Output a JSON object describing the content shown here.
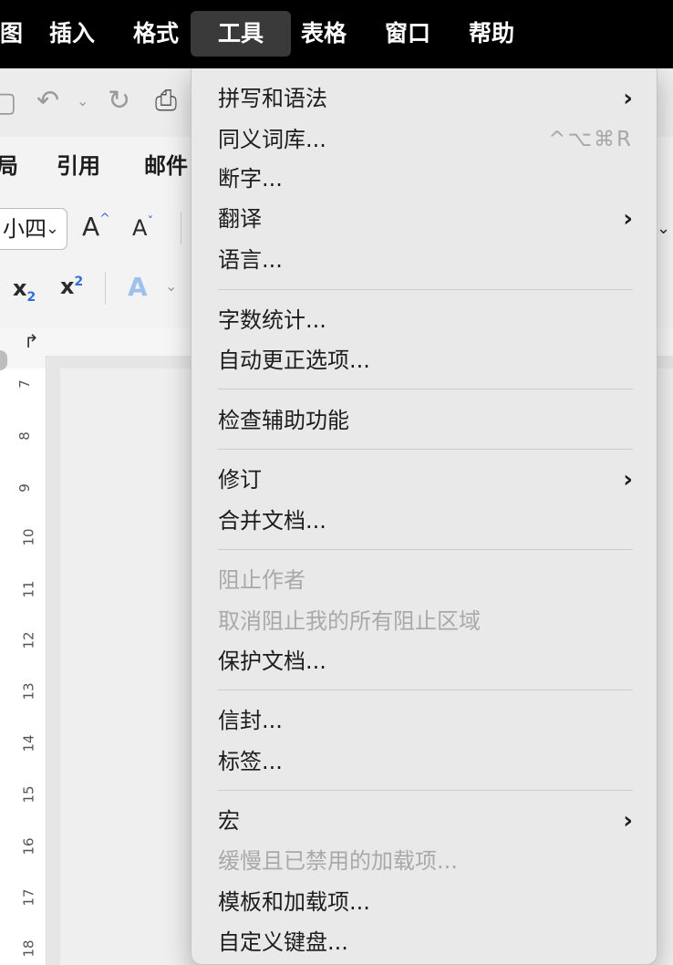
{
  "menubar": {
    "items": [
      "图",
      "插入",
      "格式",
      "工具",
      "表格",
      "窗口",
      "帮助"
    ],
    "active": "工具"
  },
  "ribbon": {
    "tabs": [
      "局",
      "引用",
      "邮件"
    ],
    "font_size": "小四",
    "subscript_label": "x",
    "subscript_mark": "2",
    "superscript_label": "x",
    "superscript_mark": "2",
    "grow_font": "A",
    "shrink_font": "A",
    "text_effect": "A"
  },
  "ruler": {
    "numbers": [
      "7",
      "8",
      "9",
      "10",
      "11",
      "12",
      "13",
      "14",
      "15",
      "16",
      "17",
      "18"
    ]
  },
  "tools_menu": {
    "spelling_grammar": "拼写和语法",
    "thesaurus": "同义词库...",
    "thesaurus_shortcut": "^⌥⌘R",
    "hyphenation": "断字...",
    "translate": "翻译",
    "language": "语言...",
    "word_count": "字数统计...",
    "autocorrect": "自动更正选项...",
    "check_accessibility": "检查辅助功能",
    "track_changes": "修订",
    "merge_documents": "合并文档...",
    "block_authors": "阻止作者",
    "unblock_all": "取消阻止我的所有阻止区域",
    "protect_document": "保护文档...",
    "envelopes": "信封...",
    "labels": "标签...",
    "macros": "宏",
    "disabled_addins": "缓慢且已禁用的加载项...",
    "templates_addins": "模板和加载项...",
    "customize_keyboard": "自定义键盘..."
  },
  "icons": {
    "submenu_arrow": "chevron-right-icon"
  }
}
